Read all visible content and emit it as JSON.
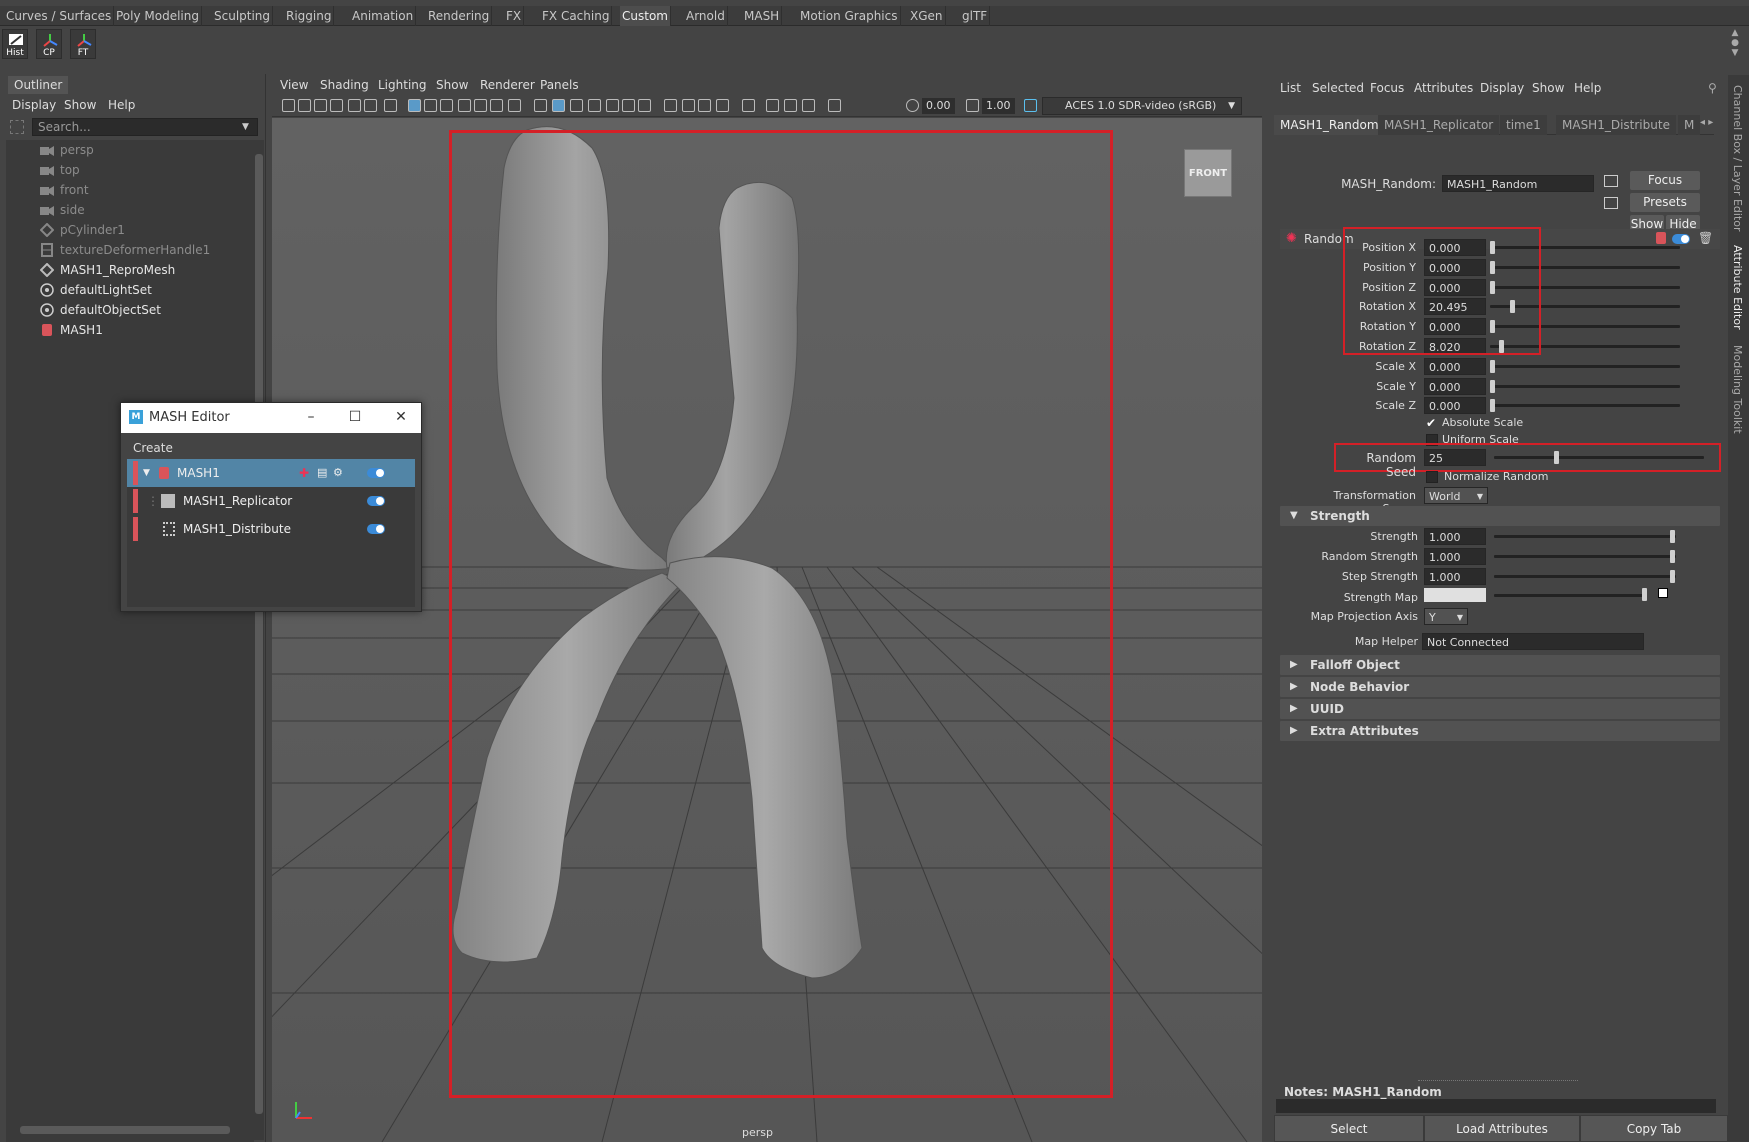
{
  "shelf": {
    "tabs": [
      "Curves / Surfaces",
      "Poly Modeling",
      "Sculpting",
      "Rigging",
      "Animation",
      "Rendering",
      "FX",
      "FX Caching",
      "Custom",
      "Arnold",
      "MASH",
      "Motion Graphics",
      "XGen",
      "glTF"
    ],
    "active_tab": "Custom",
    "buttons": [
      "Hist",
      "CP",
      "FT"
    ]
  },
  "outliner": {
    "tab": "Outliner",
    "menu": [
      "Display",
      "Show",
      "Help"
    ],
    "search_placeholder": "Search...",
    "items": [
      {
        "label": "persp",
        "icon": "camera-icon",
        "dim": true
      },
      {
        "label": "top",
        "icon": "camera-icon",
        "dim": true
      },
      {
        "label": "front",
        "icon": "camera-icon",
        "dim": true
      },
      {
        "label": "side",
        "icon": "camera-icon",
        "dim": true
      },
      {
        "label": "pCylinder1",
        "icon": "mesh-icon",
        "dim": true
      },
      {
        "label": "textureDeformerHandle1",
        "icon": "deformer-icon",
        "dim": true
      },
      {
        "label": "MASH1_ReproMesh",
        "icon": "mesh-icon",
        "dim": false
      },
      {
        "label": "defaultLightSet",
        "icon": "set-icon",
        "dim": false
      },
      {
        "label": "defaultObjectSet",
        "icon": "set-icon",
        "dim": false
      },
      {
        "label": "MASH1",
        "icon": "mash-icon",
        "dim": false
      }
    ]
  },
  "viewport": {
    "menu": [
      "View",
      "Shading",
      "Lighting",
      "Show",
      "Renderer",
      "Panels"
    ],
    "exposure": "0.00",
    "gamma": "1.00",
    "color_space": "ACES 1.0 SDR-video (sRGB)",
    "view_cube_label": "FRONT",
    "camera_label": "persp"
  },
  "mash_editor": {
    "title": "MASH Editor",
    "menu": "Create",
    "nodes": [
      "MASH1",
      "MASH1_Replicator",
      "MASH1_Distribute"
    ]
  },
  "attr_editor": {
    "menu": [
      "List",
      "Selected",
      "Focus",
      "Attributes",
      "Display",
      "Show",
      "Help"
    ],
    "tabs": [
      "MASH1_Random",
      "MASH1_Replicator",
      "time1",
      "MASH1_Distribute",
      "M"
    ],
    "node_type_label": "MASH_Random:",
    "node_name": "MASH1_Random",
    "buttons": {
      "focus": "Focus",
      "presets": "Presets",
      "show": "Show",
      "hide": "Hide"
    },
    "section_random": "Random",
    "attrs": [
      {
        "label": "Position X",
        "value": "0.000"
      },
      {
        "label": "Position Y",
        "value": "0.000"
      },
      {
        "label": "Position Z",
        "value": "0.000"
      },
      {
        "label": "Rotation X",
        "value": "20.495"
      },
      {
        "label": "Rotation Y",
        "value": "0.000"
      },
      {
        "label": "Rotation Z",
        "value": "8.020"
      },
      {
        "label": "Scale X",
        "value": "0.000"
      },
      {
        "label": "Scale Y",
        "value": "0.000"
      },
      {
        "label": "Scale Z",
        "value": "0.000"
      }
    ],
    "absolute_scale": "Absolute Scale",
    "uniform_scale": "Uniform Scale",
    "random_seed_label": "Random Seed",
    "random_seed": "25",
    "normalize_random": "Normalize Random",
    "transform_space_label": "Transformation Space",
    "transform_space": "World",
    "section_strength": "Strength",
    "strength": [
      {
        "label": "Strength",
        "value": "1.000"
      },
      {
        "label": "Random Strength",
        "value": "1.000"
      },
      {
        "label": "Step Strength",
        "value": "1.000"
      }
    ],
    "strength_map_label": "Strength Map",
    "map_axis_label": "Map Projection Axis",
    "map_axis": "Y",
    "map_helper_label": "Map Helper",
    "map_helper": "Not Connected",
    "sections": [
      "Falloff Object",
      "Node Behavior",
      "UUID",
      "Extra Attributes"
    ],
    "notes": "Notes:  MASH1_Random",
    "bottom": [
      "Select",
      "Load Attributes",
      "Copy Tab"
    ]
  },
  "side_tabs": [
    "Channel Box / Layer Editor",
    "Attribute Editor",
    "Modeling Toolkit"
  ],
  "colors": {
    "highlight_red": "#d42027",
    "mash_bar": "#d9545a",
    "toggle_blue": "#3b8bd8",
    "selection_blue": "#5285a6"
  }
}
